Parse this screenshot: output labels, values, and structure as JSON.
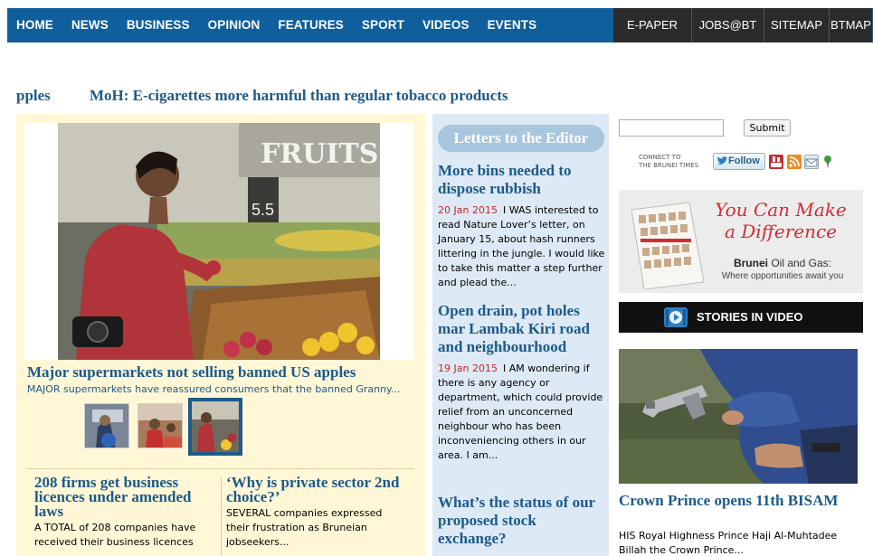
{
  "nav": {
    "left_items": [
      "HOME",
      "NEWS",
      "BUSINESS",
      "OPINION",
      "FEATURES",
      "SPORT",
      "VIDEOS",
      "EVENTS"
    ],
    "right_items": [
      "E-PAPER",
      "JOBS@BT",
      "SITEMAP",
      "BTMAP"
    ]
  },
  "ticker": {
    "items": [
      "pples",
      "MoH: E-cigarettes more harmful than regular tobacco products"
    ]
  },
  "hero": {
    "image_sign": "FRUITS",
    "image_price": "5.5",
    "title": "Major supermarkets not selling banned US apples",
    "summary": "MAJOR supermarkets have reassured consumers that the banned Granny..."
  },
  "sub_stories": [
    {
      "title": "208 firms get business licences under amended laws",
      "text": "A TOTAL of 208 companies have received their business licences"
    },
    {
      "title": "‘Why is private sector 2nd choice?’",
      "text": "SEVERAL companies expressed their frustration as Bruneian jobseekers..."
    }
  ],
  "letters": {
    "heading": "Letters to the Editor",
    "items": [
      {
        "title": "More bins needed to dispose rubbish",
        "date": "20 Jan 2015",
        "body": "I WAS interested to read Nature Lover’s letter, on January 15, about hash runners littering in the jungle. I would like to take this matter a step further and plead the..."
      },
      {
        "title": "Open drain, pot holes mar Lambak Kiri road and neighbourhood",
        "date": "19 Jan 2015",
        "body": "I AM wondering if there is any agency or department, which could provide relief from an unconcerned neighbour who has been inconveniencing others in our area. I am..."
      },
      {
        "title": "What’s the status of our proposed stock exchange?",
        "date": "",
        "body": ""
      }
    ]
  },
  "sidebar": {
    "search_value": "",
    "submit_label": "Submit",
    "connect_line1": "CONNECT TO",
    "connect_line2": "THE BRUNEI TIMES",
    "follow_label": "Follow",
    "ad_tagline_line1": "You Can Make",
    "ad_tagline_line2": "a Difference",
    "ad_brand_bold": "Brunei",
    "ad_brand_rest": " Oil and Gas:",
    "ad_sub": "Where opportunities await you",
    "stories_label": "STORIES IN VIDEO",
    "video_title": "Crown Prince opens 11th BISAM",
    "video_summary": "HIS Royal Highness Prince Haji Al-Muhtadee Billah the Crown Prince..."
  },
  "colors": {
    "nav_blue": "#0f5f9c",
    "nav_dark": "#2b2b2b",
    "link_blue": "#1d5a8a",
    "date_red": "#c0282e",
    "left_bg": "#fff7d6",
    "mid_bg": "#dde9f4"
  },
  "icons": [
    "twitter-bird-icon",
    "youtube-icon",
    "rss-icon",
    "email-icon",
    "map-pin-icon",
    "video-play-icon"
  ]
}
